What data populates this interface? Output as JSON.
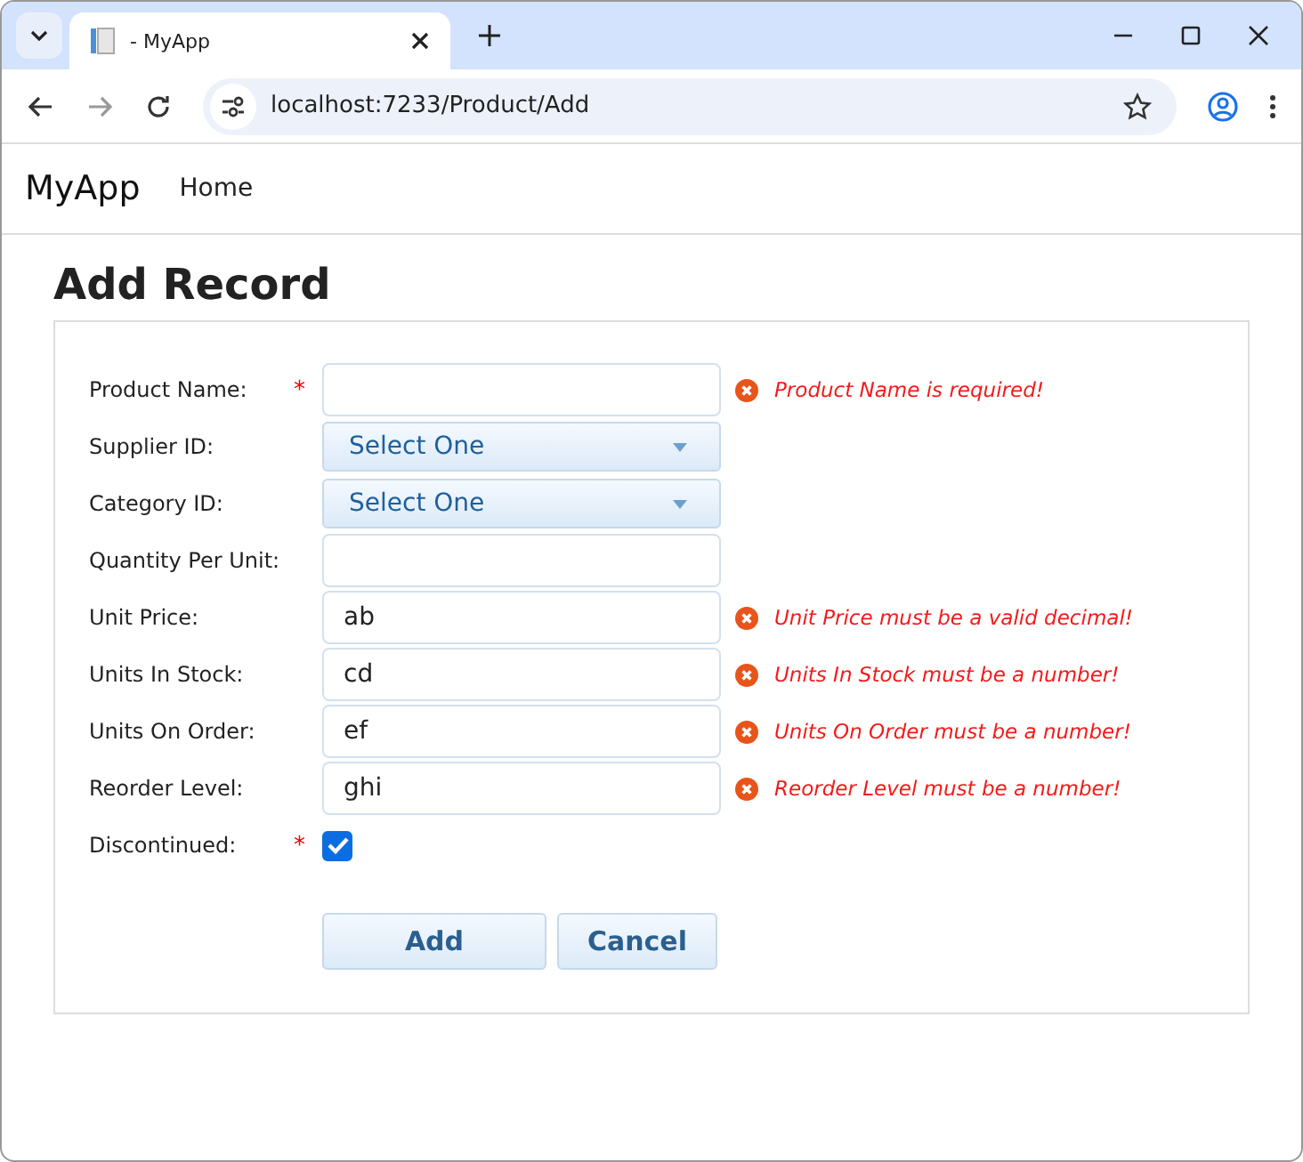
{
  "browser": {
    "tab_title": "- MyApp",
    "url": "localhost:7233/Product/Add"
  },
  "navbar": {
    "brand": "MyApp",
    "links": [
      "Home"
    ]
  },
  "page_title": "Add Record",
  "fields": [
    {
      "kind": "text",
      "label": "Product Name:",
      "required_mark": "*",
      "error": "Product Name is required!"
    },
    {
      "kind": "select",
      "label": "Supplier ID:",
      "value": "Select One"
    },
    {
      "kind": "select",
      "label": "Category ID:",
      "value": "Select One"
    },
    {
      "kind": "text",
      "label": "Quantity Per Unit:"
    },
    {
      "kind": "text",
      "label": "Unit Price:",
      "value": "ab",
      "error": "Unit Price must be a valid decimal!"
    },
    {
      "kind": "text",
      "label": "Units In Stock:",
      "value": "cd",
      "error": "Units In Stock must be a number!"
    },
    {
      "kind": "text",
      "label": "Units On Order:",
      "value": "ef",
      "error": "Units On Order must be a number!"
    },
    {
      "kind": "text",
      "label": "Reorder Level:",
      "value": "ghi",
      "error": "Reorder Level must be a number!"
    },
    {
      "kind": "checkbox",
      "label": "Discontinued:",
      "required_mark": "*",
      "checked": true
    }
  ],
  "buttons": [
    "Add",
    "Cancel"
  ]
}
